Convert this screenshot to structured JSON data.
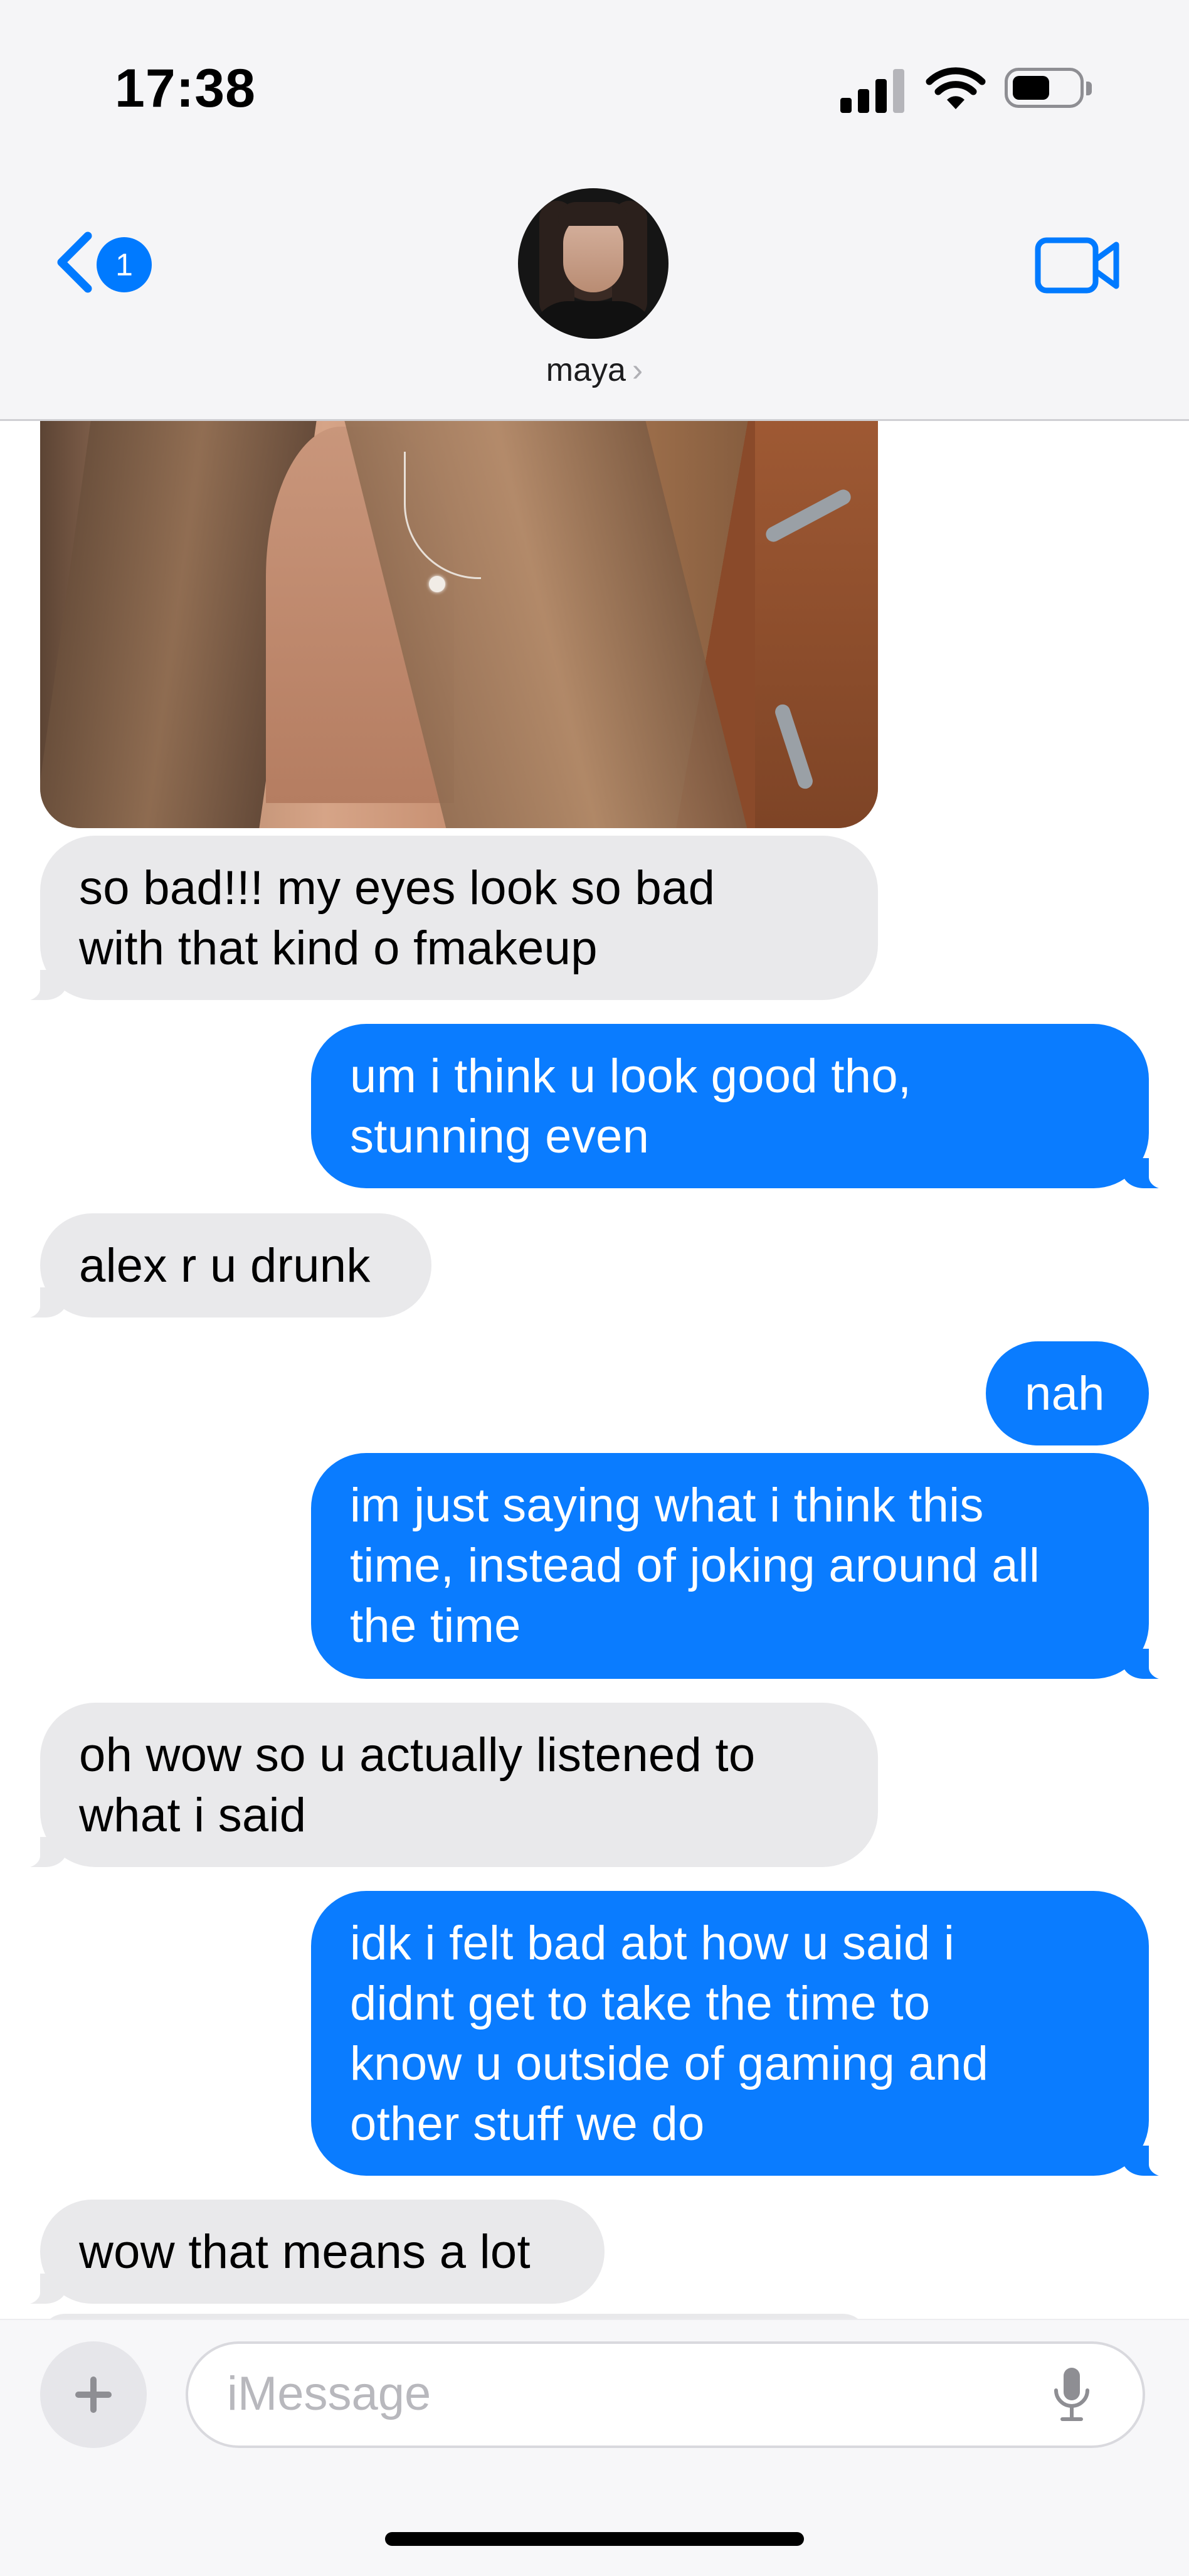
{
  "status_bar": {
    "time": "17:38"
  },
  "header": {
    "back_badge": "1",
    "contact_name": "maya",
    "chevron": "›"
  },
  "thread": [
    {
      "id": "m1",
      "direction": "incoming",
      "text": "so bad!!! my eyes look so bad\nwith that kind o fmakeup"
    },
    {
      "id": "m2",
      "direction": "outgoing",
      "text": "um i think u look good tho,\nstunning even"
    },
    {
      "id": "m3",
      "direction": "incoming",
      "text": "alex r u drunk"
    },
    {
      "id": "m4",
      "direction": "outgoing",
      "text": "nah"
    },
    {
      "id": "m5",
      "direction": "outgoing",
      "text": "im just saying what i think this\ntime, instead of joking around all\nthe time"
    },
    {
      "id": "m6",
      "direction": "incoming",
      "text": "oh wow so u actually listened to\nwhat i said"
    },
    {
      "id": "m7",
      "direction": "outgoing",
      "text": "idk i felt bad abt how u said i\ndidnt get to take the time to\nknow u outside of gaming and\nother stuff we do"
    },
    {
      "id": "m8",
      "direction": "incoming",
      "text": "wow that means a lot"
    }
  ],
  "composer": {
    "placeholder": "iMessage"
  },
  "colors": {
    "outgoing_bubble": "#0a7cff",
    "incoming_bubble": "#e9e9eb",
    "accent": "#007aff"
  },
  "icons": [
    "signal-icon",
    "wifi-icon",
    "battery-icon",
    "back-chevron-icon",
    "video-camera-icon",
    "plus-icon",
    "microphone-icon"
  ]
}
